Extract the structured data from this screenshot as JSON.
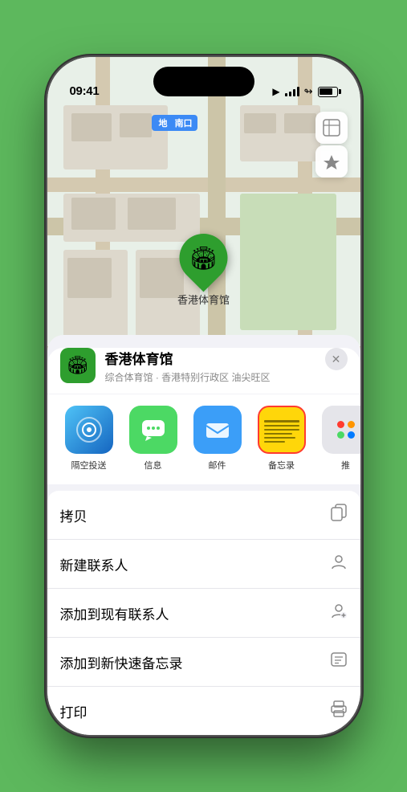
{
  "status_bar": {
    "time": "09:41",
    "location_icon": "▶"
  },
  "map": {
    "north_label": "南口",
    "venue_pin_label": "香港体育馆",
    "pin_emoji": "🏟"
  },
  "venue_header": {
    "name": "香港体育馆",
    "description": "综合体育馆 · 香港特别行政区 油尖旺区",
    "close_label": "✕",
    "logo_emoji": "🏟"
  },
  "share_items": [
    {
      "label": "隔空投送",
      "type": "airdrop"
    },
    {
      "label": "信息",
      "type": "messages"
    },
    {
      "label": "邮件",
      "type": "mail"
    },
    {
      "label": "备忘录",
      "type": "notes"
    },
    {
      "label": "推",
      "type": "more"
    }
  ],
  "action_rows": [
    {
      "label": "拷贝",
      "icon": "📋"
    },
    {
      "label": "新建联系人",
      "icon": "👤"
    },
    {
      "label": "添加到现有联系人",
      "icon": "👤"
    },
    {
      "label": "添加到新快速备忘录",
      "icon": "📝"
    },
    {
      "label": "打印",
      "icon": "🖨"
    }
  ]
}
